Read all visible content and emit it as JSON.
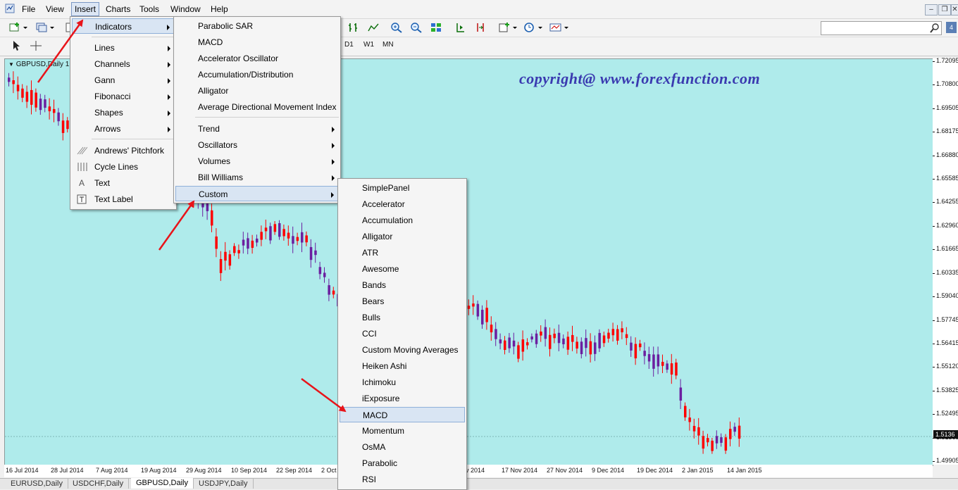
{
  "menubar": {
    "items": [
      "File",
      "View",
      "Insert",
      "Charts",
      "Tools",
      "Window",
      "Help"
    ]
  },
  "window_controls": {
    "minimize": "–",
    "restore": "❐",
    "close": "✕"
  },
  "toolbar": {
    "timeframes": [
      "D1",
      "W1",
      "MN"
    ],
    "search_placeholder": ""
  },
  "chart": {
    "title": "GBPUSD,Daily  1",
    "watermark": "copyright@ www.forexfunction.com",
    "bull_color": "#6b1fa0",
    "bear_color": "#ff0000",
    "price_levels": [
      "1.72095",
      "1.70800",
      "1.69505",
      "1.68175",
      "1.66880",
      "1.65585",
      "1.64255",
      "1.62960",
      "1.61665",
      "1.60335",
      "1.59040",
      "1.57745",
      "1.56415",
      "1.55120",
      "1.53825",
      "1.52495",
      "1.51365",
      "1.49905"
    ],
    "current_price": "1.5136",
    "dates": [
      "16 Jul 2014",
      "28 Jul 2014",
      "7 Aug 2014",
      "19 Aug 2014",
      "29 Aug 2014",
      "10 Sep 2014",
      "22 Sep 2014",
      "2 Oct",
      "ov 2014",
      "17 Nov 2014",
      "27 Nov 2014",
      "9 Dec 2014",
      "19 Dec 2014",
      "2 Jan 2015",
      "14 Jan 2015"
    ]
  },
  "tabs": [
    "EURUSD,Daily",
    "USDCHF,Daily",
    "GBPUSD,Daily",
    "USDJPY,Daily"
  ],
  "insert_menu": {
    "items": [
      {
        "label": "Indicators",
        "icon": "",
        "submenu": true
      },
      {
        "label": "Lines",
        "icon": "",
        "submenu": true
      },
      {
        "label": "Channels",
        "icon": "",
        "submenu": true
      },
      {
        "label": "Gann",
        "icon": "",
        "submenu": true
      },
      {
        "label": "Fibonacci",
        "icon": "",
        "submenu": true
      },
      {
        "label": "Shapes",
        "icon": "",
        "submenu": true
      },
      {
        "label": "Arrows",
        "icon": "",
        "submenu": true
      },
      {
        "label": "Andrews' Pitchfork",
        "icon": "pitchfork-icon",
        "submenu": false
      },
      {
        "label": "Cycle Lines",
        "icon": "cycle-lines-icon",
        "submenu": false
      },
      {
        "label": "Text",
        "icon": "text-icon",
        "submenu": false
      },
      {
        "label": "Text Label",
        "icon": "text-label-icon",
        "submenu": false
      }
    ]
  },
  "indicators_menu": {
    "items": [
      {
        "label": "Parabolic SAR",
        "submenu": false
      },
      {
        "label": "MACD",
        "submenu": false
      },
      {
        "label": "Accelerator Oscillator",
        "submenu": false
      },
      {
        "label": "Accumulation/Distribution",
        "submenu": false
      },
      {
        "label": "Alligator",
        "submenu": false
      },
      {
        "label": "Average Directional Movement Index",
        "submenu": false
      },
      {
        "label": "Trend",
        "submenu": true
      },
      {
        "label": "Oscillators",
        "submenu": true
      },
      {
        "label": "Volumes",
        "submenu": true
      },
      {
        "label": "Bill Williams",
        "submenu": true
      },
      {
        "label": "Custom",
        "submenu": true
      }
    ]
  },
  "custom_menu": {
    "items": [
      "SimplePanel",
      "Accelerator",
      "Accumulation",
      "Alligator",
      "ATR",
      "Awesome",
      "Bands",
      "Bears",
      "Bulls",
      "CCI",
      "Custom Moving Averages",
      "Heiken Ashi",
      "Ichimoku",
      "iExposure",
      "MACD",
      "Momentum",
      "OsMA",
      "Parabolic",
      "RSI"
    ]
  }
}
